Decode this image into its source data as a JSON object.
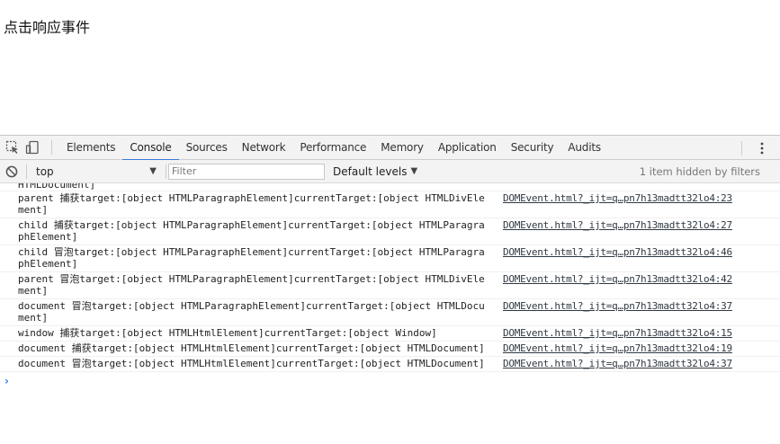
{
  "page": {
    "text": "点击响应事件"
  },
  "devtools": {
    "tabs": [
      {
        "label": "Elements"
      },
      {
        "label": "Console"
      },
      {
        "label": "Sources"
      },
      {
        "label": "Network"
      },
      {
        "label": "Performance"
      },
      {
        "label": "Memory"
      },
      {
        "label": "Application"
      },
      {
        "label": "Security"
      },
      {
        "label": "Audits"
      }
    ],
    "active_tab": "Console",
    "toolbar": {
      "context": "top",
      "filter_placeholder": "Filter",
      "levels": "Default levels",
      "hidden_info": "1 item hidden by filters"
    },
    "cut_line": "HTMLDocument]",
    "messages": [
      {
        "text": "parent 捕获target:[object HTMLParagraphElement]currentTarget:[object HTMLDivElement]",
        "source": "DOMEvent.html?_ijt=q…pn7h13madtt32lo4:23"
      },
      {
        "text": "child 捕获target:[object HTMLParagraphElement]currentTarget:[object HTMLParagraphElement]",
        "source": "DOMEvent.html?_ijt=q…pn7h13madtt32lo4:27"
      },
      {
        "text": "child 冒泡target:[object HTMLParagraphElement]currentTarget:[object HTMLParagraphElement]",
        "source": "DOMEvent.html?_ijt=q…pn7h13madtt32lo4:46"
      },
      {
        "text": "parent 冒泡target:[object HTMLParagraphElement]currentTarget:[object HTMLDivElement]",
        "source": "DOMEvent.html?_ijt=q…pn7h13madtt32lo4:42"
      },
      {
        "text": "document 冒泡target:[object HTMLParagraphElement]currentTarget:[object HTMLDocument]",
        "source": "DOMEvent.html?_ijt=q…pn7h13madtt32lo4:37"
      },
      {
        "text": "window 捕获target:[object HTMLHtmlElement]currentTarget:[object Window]",
        "source": "DOMEvent.html?_ijt=q…pn7h13madtt32lo4:15"
      },
      {
        "text": "document 捕获target:[object HTMLHtmlElement]currentTarget:[object HTMLDocument]",
        "source": "DOMEvent.html?_ijt=q…pn7h13madtt32lo4:19"
      },
      {
        "text": "document 冒泡target:[object HTMLHtmlElement]currentTarget:[object HTMLDocument]",
        "source": "DOMEvent.html?_ijt=q…pn7h13madtt32lo4:37"
      }
    ],
    "icons": {
      "inspect": "inspect-element-icon",
      "device": "device-toolbar-icon",
      "menu": "more-menu-icon",
      "clear": "clear-console-icon",
      "prompt": "console-prompt-icon"
    }
  }
}
